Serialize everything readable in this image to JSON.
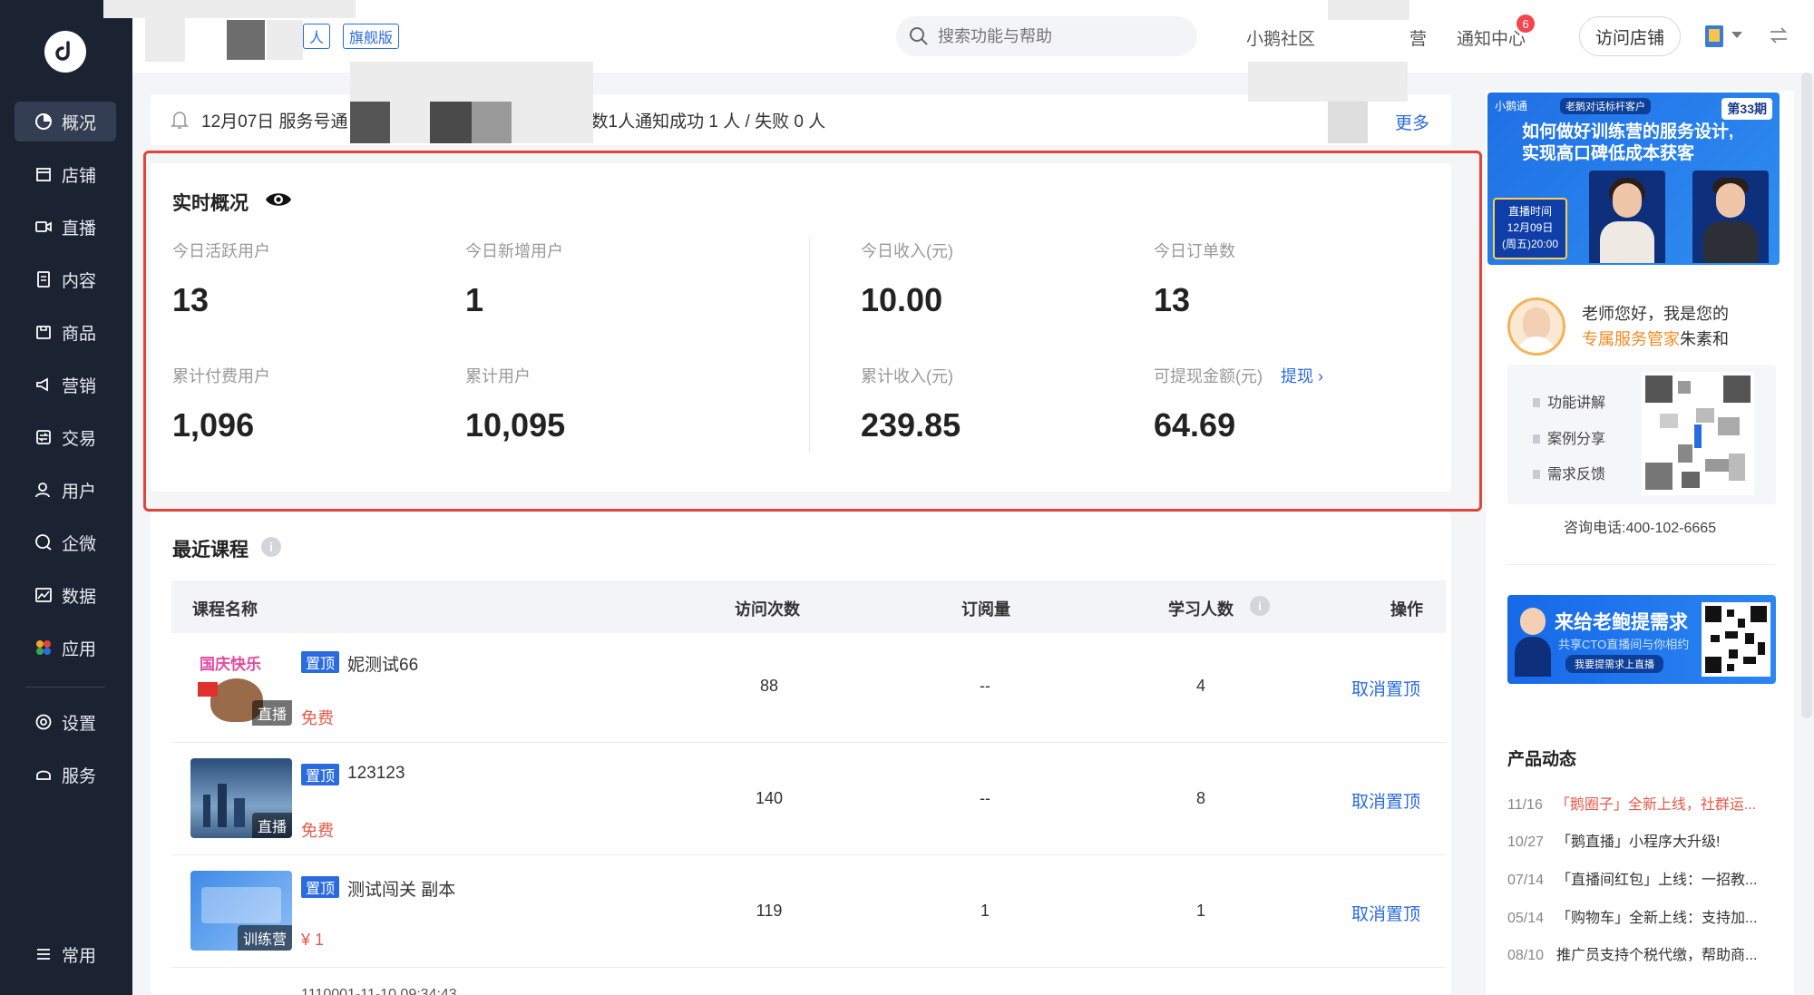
{
  "nav": {
    "items": [
      {
        "label": "概况",
        "icon": "overview-icon",
        "active": true
      },
      {
        "label": "店铺",
        "icon": "store-icon"
      },
      {
        "label": "直播",
        "icon": "live-icon"
      },
      {
        "label": "内容",
        "icon": "content-icon"
      },
      {
        "label": "商品",
        "icon": "goods-icon"
      },
      {
        "label": "营销",
        "icon": "marketing-icon"
      },
      {
        "label": "交易",
        "icon": "trade-icon"
      },
      {
        "label": "用户",
        "icon": "user-icon"
      },
      {
        "label": "企微",
        "icon": "wecom-icon"
      },
      {
        "label": "数据",
        "icon": "data-icon"
      },
      {
        "label": "应用",
        "icon": "apps-icon"
      },
      {
        "label": "设置",
        "icon": "settings-icon"
      },
      {
        "label": "服务",
        "icon": "service-icon"
      },
      {
        "label": "常用",
        "icon": "frequent-icon"
      }
    ]
  },
  "topbar": {
    "tag_personal": "人",
    "tag_flagship": "旗舰版",
    "search_placeholder": "搜索功能与帮助",
    "community": "小鹅社区",
    "partial_text": "营",
    "notifications": "通知中心",
    "notification_count": "6",
    "visit_store": "访问店铺"
  },
  "notice": {
    "prefix": "12月07日 服务号通",
    "suffix": "数1人通知成功 1 人 / 失败 0 人",
    "more": "更多"
  },
  "overview": {
    "title": "实时概况",
    "metrics": [
      {
        "label": "今日活跃用户",
        "value": "13"
      },
      {
        "label": "今日新增用户",
        "value": "1"
      },
      {
        "label": "今日收入(元)",
        "value": "10.00"
      },
      {
        "label": "今日订单数",
        "value": "13"
      },
      {
        "label": "累计付费用户",
        "value": "1,096"
      },
      {
        "label": "累计用户",
        "value": "10,095"
      },
      {
        "label": "累计收入(元)",
        "value": "239.85"
      },
      {
        "label": "可提现金额(元)",
        "value": "64.69"
      }
    ],
    "withdraw": "提现 ›"
  },
  "courses": {
    "title": "最近课程",
    "columns": [
      "课程名称",
      "访问次数",
      "订阅量",
      "学习人数",
      "操作"
    ],
    "rows": [
      {
        "pin": "置顶",
        "name": "妮测试66",
        "price": "免费",
        "thumb_tag": "直播",
        "thumb_text": "国庆快乐",
        "visits": "88",
        "subs": "--",
        "learners": "4",
        "action": "取消置顶"
      },
      {
        "pin": "置顶",
        "name": "123123",
        "price": "免费",
        "thumb_tag": "直播",
        "visits": "140",
        "subs": "--",
        "learners": "8",
        "action": "取消置顶"
      },
      {
        "pin": "置顶",
        "name": "测试闯关 副本",
        "price": "¥ 1",
        "thumb_tag": "训练营",
        "visits": "119",
        "subs": "1",
        "learners": "1",
        "action": "取消置顶"
      }
    ],
    "partial_next": "1110001-11-10 09:34:43"
  },
  "sidebar": {
    "banner": {
      "brand": "小鹅通",
      "badge": "老鹅对话标杆客户",
      "issue": "第33期",
      "line1": "如何做好训练营的服务设计,",
      "line2": "实现高口碑低成本获客",
      "live_label": "直播时间",
      "live_date": "12月09日",
      "live_time": "(周五)20:00"
    },
    "greeting_line1": "老师您好，我是您的",
    "greeting_highlight": "专属服务管家",
    "greeting_name": "朱素和",
    "bullets": [
      "功能讲解",
      "案例分享",
      "需求反馈"
    ],
    "phone": "咨询电话:400-102-6665",
    "banner2": {
      "title": "来给老鲍提需求",
      "subtitle": "共享CTO直播间与你相约",
      "button": "我要提需求上直播"
    },
    "news_title": "产品动态",
    "news": [
      {
        "date": "11/16",
        "text": "「鹅圈子」全新上线，社群运...",
        "red": true
      },
      {
        "date": "10/27",
        "text": "「鹅直播」小程序大升级!",
        "red": false
      },
      {
        "date": "07/14",
        "text": "「直播间红包」上线：一招教...",
        "red": false
      },
      {
        "date": "05/14",
        "text": "「购物车」全新上线：支持加...",
        "red": false
      },
      {
        "date": "08/10",
        "text": "推广员支持个税代缴，帮助商...",
        "red": false
      }
    ]
  },
  "colors": {
    "accent": "#2a6be0",
    "nav_bg": "#1b2333",
    "highlight": "#e0453b",
    "price": "#e45a4a"
  }
}
